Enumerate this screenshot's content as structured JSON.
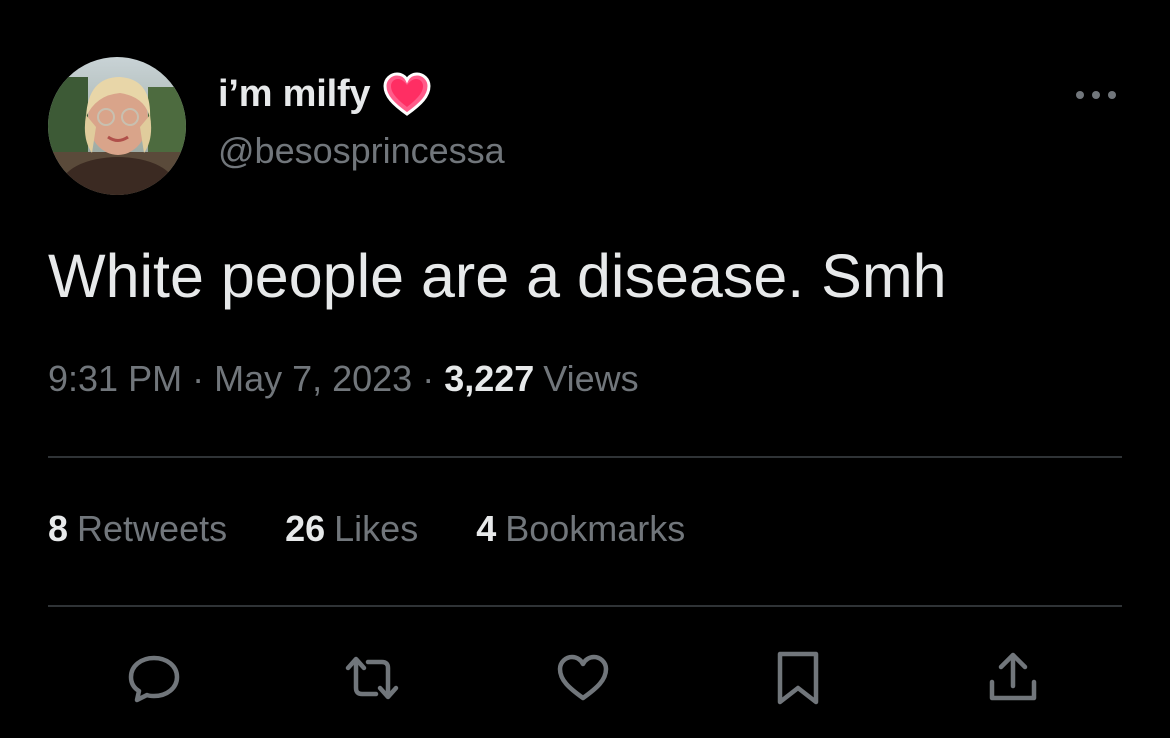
{
  "author": {
    "display_name": "i’m milfy",
    "handle": "@besosprincessa",
    "avatar_icon": "profile-photo"
  },
  "tweet": {
    "text": "White people are a disease. Smh"
  },
  "meta": {
    "time": "9:31 PM",
    "separator": "·",
    "date": "May 7, 2023",
    "views_count": "3,227",
    "views_label": "Views"
  },
  "stats": {
    "retweets": {
      "count": "8",
      "label": "Retweets"
    },
    "likes": {
      "count": "26",
      "label": "Likes"
    },
    "bookmarks": {
      "count": "4",
      "label": "Bookmarks"
    }
  },
  "actions": [
    "reply-icon",
    "retweet-icon",
    "like-icon",
    "bookmark-icon",
    "share-icon"
  ],
  "colors": {
    "background": "#000000",
    "primary_text": "#e7e9ea",
    "secondary_text": "#71767b",
    "divider": "#2f3336",
    "heart_emoji": "#ff5c8a"
  }
}
